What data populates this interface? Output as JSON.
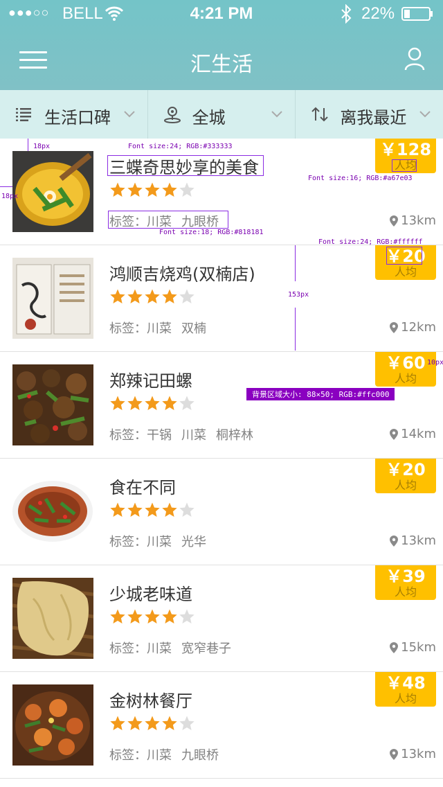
{
  "status": {
    "signal": "●●●○○",
    "carrier": "BELL",
    "time": "4:21 PM",
    "battery": "22%"
  },
  "header": {
    "title": "汇生活"
  },
  "filters": [
    {
      "label": "生活口碑",
      "icon": "list-icon"
    },
    {
      "label": "全城",
      "icon": "location-icon"
    },
    {
      "label": "离我最近",
      "icon": "sort-icon"
    }
  ],
  "colors": {
    "header": "#7cc3c7",
    "filter_bg": "#d6efee",
    "badge": "#ffc000",
    "title": "#333333",
    "tag": "#818181",
    "per": "#a67e03",
    "star": "#f39a1b"
  },
  "items": [
    {
      "name": "三蝶奇思妙享的美食",
      "rating": 4,
      "tag_label": "标签：",
      "tags": [
        "川菜",
        "九眼桥"
      ],
      "price": "￥128",
      "per": "人均",
      "distance": "13km"
    },
    {
      "name": "鸿顺吉烧鸡(双楠店)",
      "rating": 4,
      "tag_label": "标签：",
      "tags": [
        "川菜",
        "双楠"
      ],
      "price": "￥20",
      "per": "人均",
      "distance": "12km"
    },
    {
      "name": "郑辣记田螺",
      "rating": 4,
      "tag_label": "标签：",
      "tags": [
        "干锅",
        "川菜",
        "桐梓林"
      ],
      "price": "￥60",
      "per": "人均",
      "distance": "14km"
    },
    {
      "name": "食在不同",
      "rating": 4,
      "tag_label": "标签：",
      "tags": [
        "川菜",
        "光华"
      ],
      "price": "￥20",
      "per": "人均",
      "distance": "13km"
    },
    {
      "name": "少城老味道",
      "rating": 4,
      "tag_label": "标签：",
      "tags": [
        "川菜",
        "宽窄巷子"
      ],
      "price": "￥39",
      "per": "人均",
      "distance": "15km"
    },
    {
      "name": "金树林餐厅",
      "rating": 4,
      "tag_label": "标签：",
      "tags": [
        "川菜",
        "九眼桥"
      ],
      "price": "￥48",
      "per": "人均",
      "distance": "13km"
    }
  ],
  "annotations": {
    "a1": "18px",
    "a2": "Font size:24; RGB:#333333",
    "a3": "18px",
    "a4": "Font size:16; RGB:#a67e03",
    "a5": "Font size:18; RGB:#818181",
    "a6": "Font size:24; RGB:#ffffff",
    "a7": "153px",
    "a8": "10px",
    "a9": "背景区域大小: 88×50; RGB:#ffc000"
  }
}
